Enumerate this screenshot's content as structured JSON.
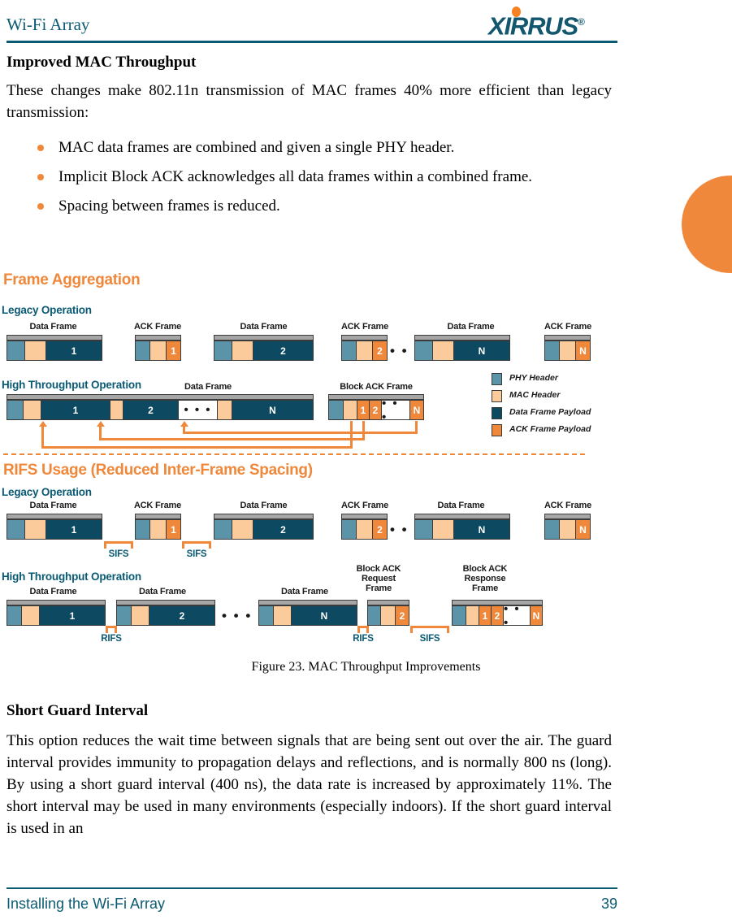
{
  "header": {
    "title": "Wi-Fi Array",
    "logo_text": "XIRRUS",
    "logo_reg": "®"
  },
  "colors": {
    "brand_teal": "#0b5a73",
    "brand_orange": "#f0883b",
    "phy_header": "#5b93a8",
    "mac_header": "#fbcb9b",
    "data_payload": "#0d4a61",
    "ack_payload": "#f0883b",
    "frame_topbar": "#a6a6a6"
  },
  "body": {
    "section_heading": "Improved MAC Throughput",
    "intro_paragraph": "These changes make 802.11n transmission of MAC frames 40% more efficient than legacy transmission:",
    "bullets": [
      "MAC data frames are combined and given a single PHY header.",
      "Implicit Block ACK acknowledges all data frames within a combined frame.",
      "Spacing between frames is reduced."
    ]
  },
  "figure": {
    "caption": "Figure 23. MAC Throughput Improvements",
    "sections": [
      {
        "title": "Frame Aggregation"
      },
      {
        "title": "RIFS Usage (Reduced Inter-Frame Spacing)"
      }
    ],
    "group_labels": {
      "legacy": "Legacy Operation",
      "high_throughput": "High Throughput Operation"
    },
    "frame_labels": {
      "data_frame": "Data Frame",
      "ack_frame": "ACK Frame",
      "block_ack_frame": "Block ACK Frame",
      "block_ack_request_frame": "Block ACK\nRequest\nFrame",
      "block_ack_request_frame_l1": "Block ACK",
      "block_ack_request_frame_l2": "Request",
      "block_ack_request_frame_l3": "Frame",
      "block_ack_response_frame_l1": "Block ACK",
      "block_ack_response_frame_l2": "Response",
      "block_ack_response_frame_l3": "Frame"
    },
    "payload_ids": {
      "one": "1",
      "two": "2",
      "n": "N"
    },
    "ellipsis": "• • •",
    "spacing_labels": {
      "sifs": "SIFS",
      "rifs": "RIFS"
    },
    "legend": [
      {
        "label": "PHY Header",
        "color": "#5b93a8"
      },
      {
        "label": "MAC Header",
        "color": "#fbcb9b"
      },
      {
        "label": "Data Frame Payload",
        "color": "#0d4a61"
      },
      {
        "label": "ACK Frame Payload",
        "color": "#f0883b"
      }
    ]
  },
  "body2": {
    "section_heading": "Short Guard Interval",
    "paragraph": "This option reduces the wait time between signals that are being sent out over the air. The guard interval provides immunity to propagation delays and reflections, and is normally 800 ns (long). By using a short guard interval (400 ns), the data rate is increased by approximately 11%. The short interval may be used in many environments (especially indoors). If the short guard interval is used in an"
  },
  "footer": {
    "left": "Installing the Wi-Fi Array",
    "page": "39"
  }
}
